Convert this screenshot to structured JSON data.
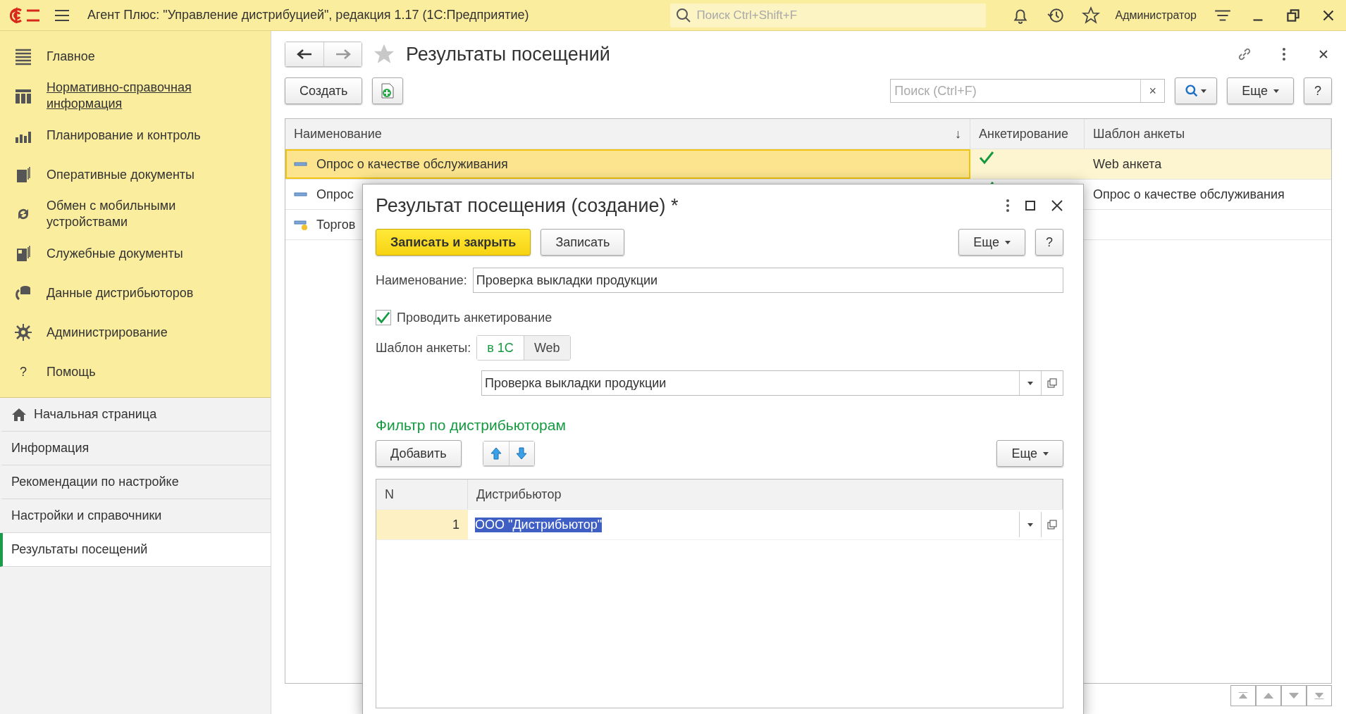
{
  "app": {
    "title": "Агент Плюс: \"Управление дистрибуцией\", редакция 1.17  (1С:Предприятие)",
    "search_placeholder": "Поиск Ctrl+Shift+F",
    "user": "Администратор"
  },
  "sections": [
    {
      "label": "Главное",
      "hovered": false
    },
    {
      "label": "Нормативно-справочная информация",
      "hovered": true
    },
    {
      "label": "Планирование и контроль",
      "hovered": false
    },
    {
      "label": "Оперативные документы",
      "hovered": false
    },
    {
      "label": "Обмен с мобильными устройствами",
      "hovered": false
    },
    {
      "label": "Служебные документы",
      "hovered": false
    },
    {
      "label": "Данные дистрибьюторов",
      "hovered": false
    },
    {
      "label": "Администрирование",
      "hovered": false
    },
    {
      "label": "Помощь",
      "hovered": false,
      "icon_char": "?"
    }
  ],
  "open_windows": [
    {
      "label": "Начальная страница",
      "kind": "home",
      "selected": false
    },
    {
      "label": "Информация",
      "kind": "page",
      "selected": false
    },
    {
      "label": "Рекомендации по настройке",
      "kind": "page",
      "selected": false
    },
    {
      "label": "Настройки и справочники",
      "kind": "page",
      "selected": false
    },
    {
      "label": "Результаты посещений",
      "kind": "page",
      "selected": true
    }
  ],
  "form": {
    "title": "Результаты посещений",
    "create": "Создать",
    "search_placeholder": "Поиск (Ctrl+F)",
    "clear": "×",
    "more": "Еще",
    "help": "?",
    "columns": [
      {
        "label": "Наименование",
        "sort_mark": "↓"
      },
      {
        "label": "Анкетирование"
      },
      {
        "label": "Шаблон анкеты"
      }
    ],
    "rows": [
      {
        "name": "Опрос о качестве обслуживания",
        "kind": "item",
        "surveyed": true,
        "template": "Web анкета",
        "selected": true
      },
      {
        "name": "Опрос",
        "kind": "item",
        "surveyed": true,
        "template": "Опрос о качестве обслуживания",
        "selected": false
      },
      {
        "name": "Торгов",
        "kind": "marked",
        "surveyed": false,
        "selected": false
      }
    ]
  },
  "dialog": {
    "title": "Результат посещения (создание) *",
    "save_close": "Записать и закрыть",
    "save": "Записать",
    "more": "Еще",
    "help": "?",
    "name_label": "Наименование:",
    "name_value": "Проверка выкладки продукции",
    "survey": {
      "label": "Проводить анкетирование",
      "checked": true
    },
    "template_label": "Шаблон анкеты:",
    "template_options": [
      {
        "label": "в 1С",
        "selected": true
      },
      {
        "label": "Web",
        "selected": false
      }
    ],
    "template_value": "Проверка выкладки продукции",
    "filter_title": "Фильтр по дистрибьюторам",
    "add": "Добавить",
    "filter_more": "Еще",
    "columns": [
      "N",
      "Дистрибьютор"
    ],
    "rows": [
      {
        "n": "1",
        "distributor": "ООО \"Дистрибьютор\"",
        "selected": true
      }
    ]
  }
}
